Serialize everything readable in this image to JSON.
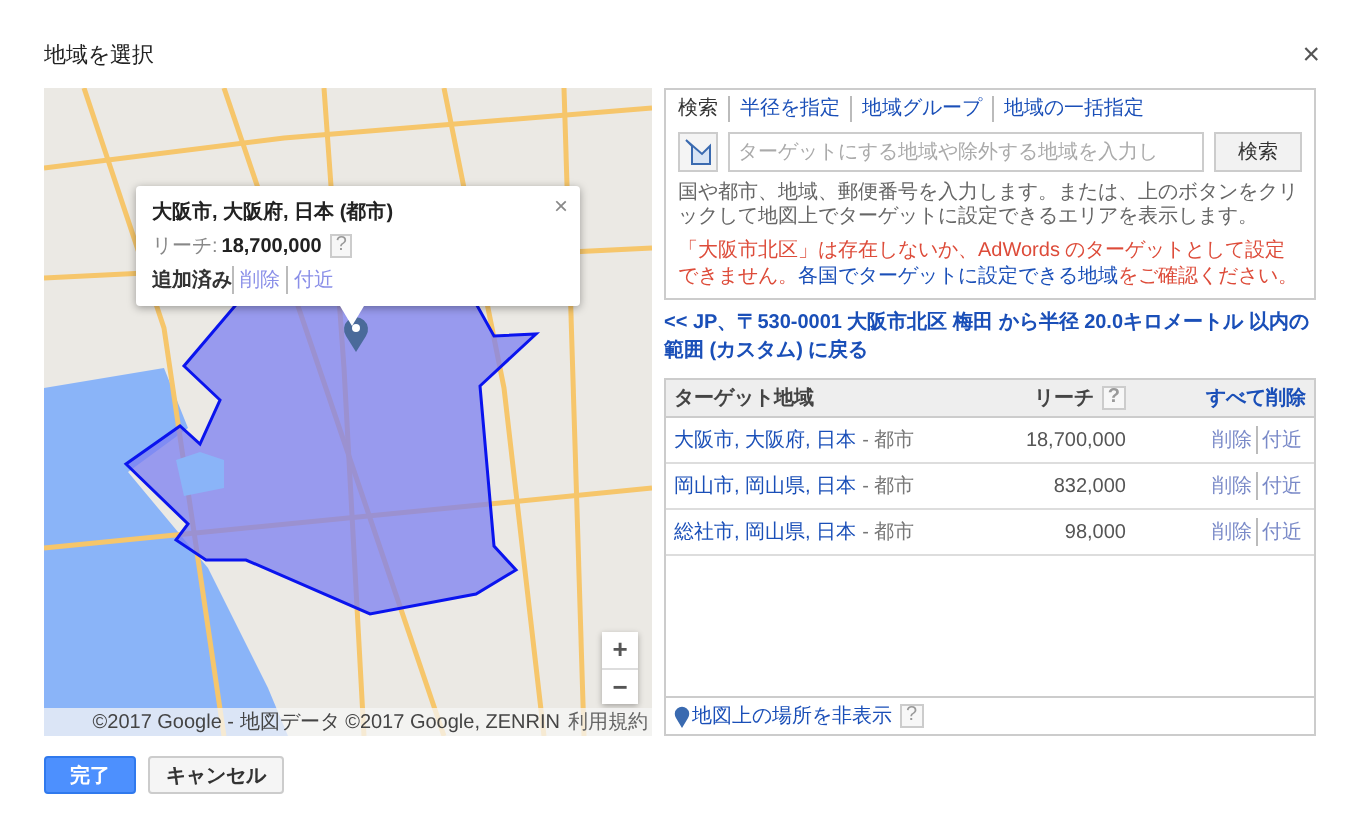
{
  "dialog": {
    "title": "地域を選択",
    "close": "×"
  },
  "map": {
    "popup": {
      "title": "大阪市, 大阪府, 日本 (都市)",
      "reach_label": "リーチ:",
      "reach_value": "18,700,000",
      "help": "?",
      "status": "追加済み",
      "actions": [
        "削除",
        "付近"
      ],
      "close": "×"
    },
    "zoom_in": "+",
    "zoom_out": "−",
    "attribution": "©2017 Google - 地図データ ©2017 Google, ZENRIN",
    "terms": "利用規約"
  },
  "search": {
    "tabs": [
      {
        "label": "検索",
        "selected": true
      },
      {
        "label": "半径を指定",
        "selected": false
      },
      {
        "label": "地域グループ",
        "selected": false
      },
      {
        "label": "地域の一括指定",
        "selected": false
      }
    ],
    "placeholder": "ターゲットにする地域や除外する地域を入力し",
    "button": "検索",
    "help_text": "国や都市、地域、郵便番号を入力します。または、上のボタンをクリックして地図上でターゲットに設定できるエリアを表示します。",
    "error": {
      "text": "「大阪市北区」は存在しないか、AdWords のターゲットとして設定できません。",
      "link": "各国でターゲットに設定できる地域",
      "after": "をご確認ください。"
    }
  },
  "back_link": "<< JP、〒530-0001 大阪市北区 梅田 から半径 20.0キロメートル 以内の範囲 (カスタム) に戻る",
  "targets": {
    "columns": [
      "ターゲット地域",
      "リーチ"
    ],
    "help": "?",
    "remove_all": "すべて削除",
    "rows": [
      {
        "name": "大阪市, 大阪府, 日本",
        "type": "- 都市",
        "reach": "18,700,000",
        "actions": [
          "削除",
          "付近"
        ]
      },
      {
        "name": "岡山市, 岡山県, 日本",
        "type": "- 都市",
        "reach": "832,000",
        "actions": [
          "削除",
          "付近"
        ]
      },
      {
        "name": "総社市, 岡山県, 日本",
        "type": "- 都市",
        "reach": "98,000",
        "actions": [
          "削除",
          "付近"
        ]
      }
    ],
    "footer_link": "地図上の場所を非表示",
    "footer_help": "?"
  },
  "buttons": [
    {
      "label": "完了",
      "kind": "primary"
    },
    {
      "label": "キャンセル",
      "kind": "secondary"
    }
  ]
}
